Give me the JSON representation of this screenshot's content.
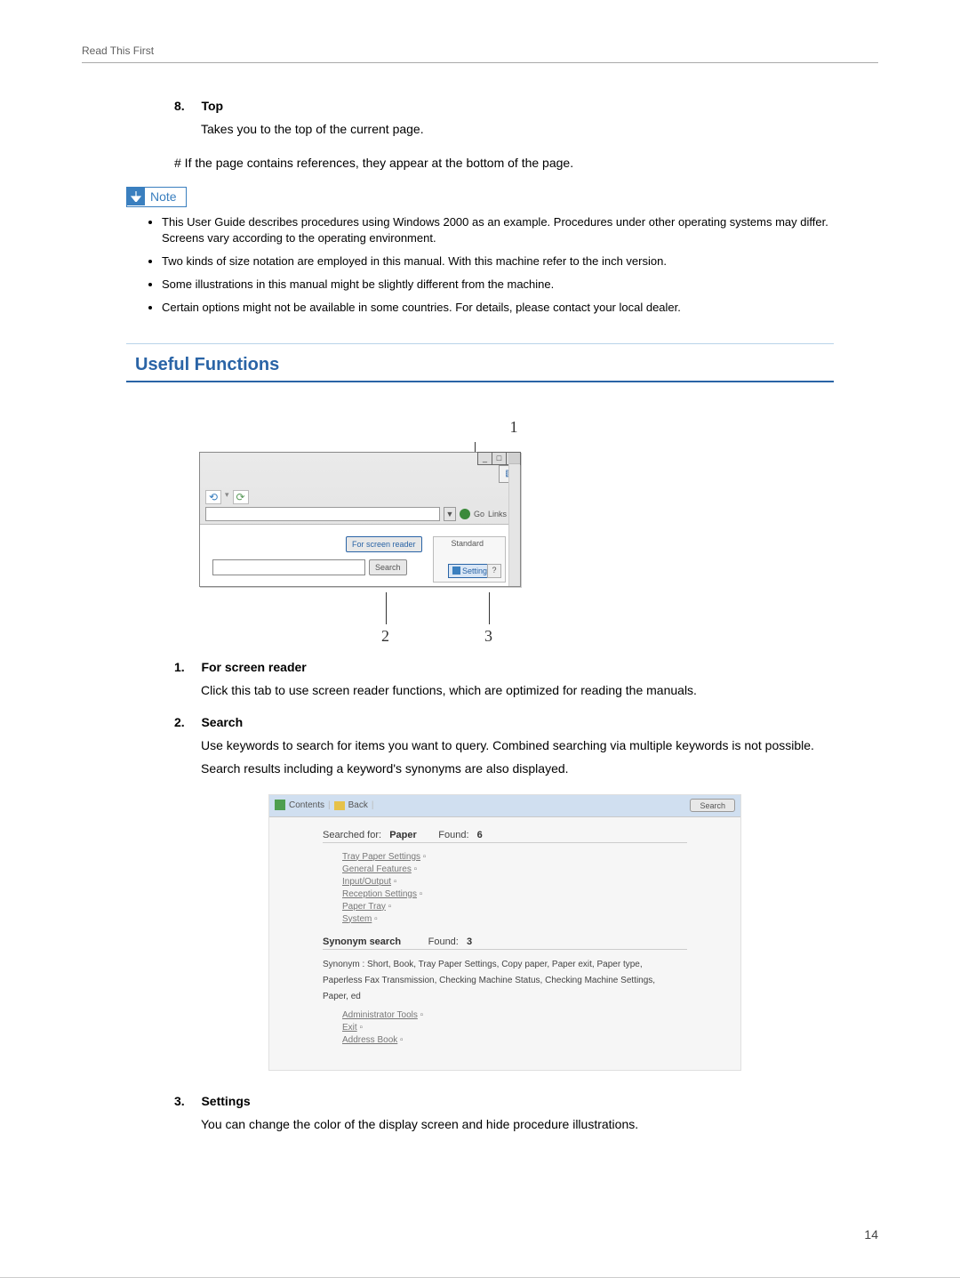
{
  "running_head": "Read This First",
  "page_number": "14",
  "item8": {
    "num": "8.",
    "title": "Top",
    "body": "Takes you to the top of the current page."
  },
  "hash_line": "# If the page contains references, they appear at the bottom of the page.",
  "note_label": "Note",
  "note_bullets": [
    "This User Guide describes procedures using Windows 2000 as an example. Procedures under other operating systems may differ. Screens vary according to the operating environment.",
    "Two kinds of size notation are employed in this manual. With this machine refer to the inch version.",
    "Some illustrations in this manual might be slightly different from the machine.",
    "Certain options might not be available in some countries. For details, please contact your local dealer."
  ],
  "section_title": "Useful Functions",
  "fig1": {
    "callout1": "1",
    "callout2": "2",
    "callout3": "3",
    "for_screen_reader_tab": "For screen reader",
    "standard_label": "Standard",
    "search_button": "Search",
    "settings_button": "Settings",
    "go_label": "Go",
    "links_label": "Links"
  },
  "item1": {
    "num": "1.",
    "title": "For screen reader",
    "body": "Click this tab to use screen reader functions, which are optimized for reading the manuals."
  },
  "item2": {
    "num": "2.",
    "title": "Search",
    "body1": "Use keywords to search for items you want to query. Combined searching via multiple keywords is not possible.",
    "body2": "Search results including a keyword's synonyms are also displayed."
  },
  "fig2": {
    "toolbar_contents": "Contents",
    "toolbar_back": "Back",
    "search_btn": "Search",
    "searched_for_label": "Searched for:",
    "searched_for_value": "Paper",
    "found_label": "Found:",
    "found_value": "6",
    "links1": [
      "Tray Paper Settings",
      "General Features",
      "Input/Output",
      "Reception Settings",
      "Paper Tray",
      "System"
    ],
    "synonym_header_label": "Synonym search",
    "synonym_found_value": "3",
    "syn_line1": "Synonym : Short, Book, Tray Paper Settings, Copy paper, Paper exit, Paper type,",
    "syn_line2": "Paperless Fax Transmission, Checking Machine Status, Checking Machine Settings,",
    "syn_line3": "Paper, ed",
    "links2": [
      "Administrator Tools",
      "Exit",
      "Address Book"
    ]
  },
  "item3": {
    "num": "3.",
    "title": "Settings",
    "body": "You can change the color of the display screen and hide procedure illustrations."
  }
}
